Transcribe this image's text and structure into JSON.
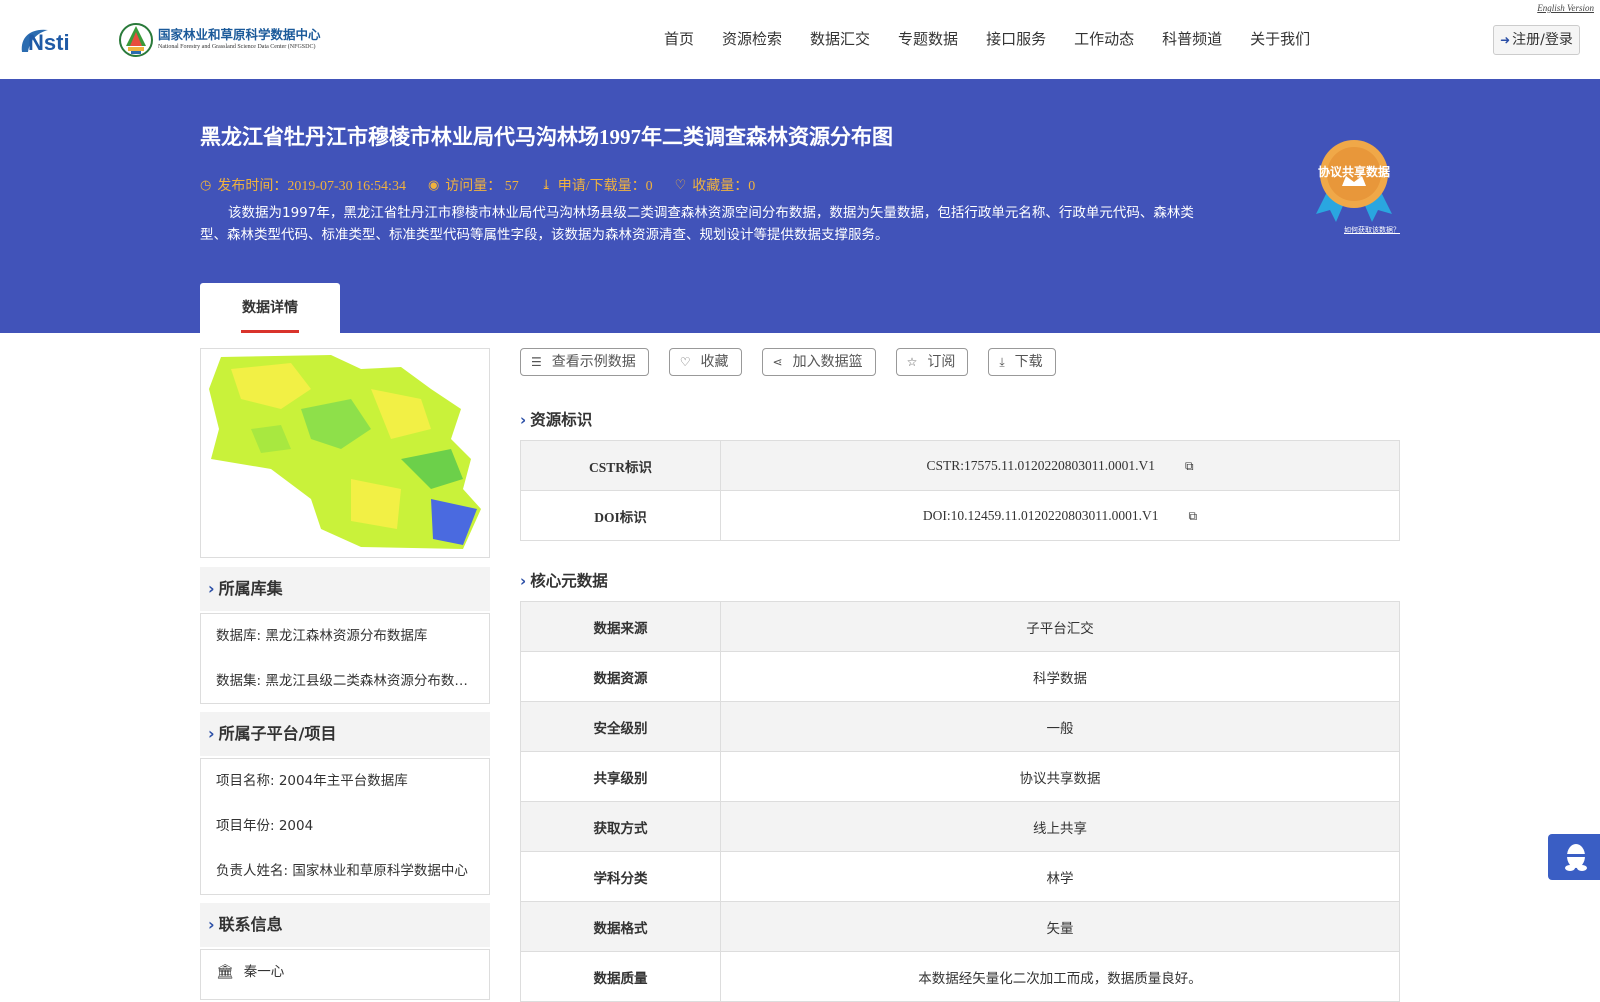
{
  "header": {
    "english_link": "English Version",
    "logo_nsti": "NSTI",
    "center_name_cn": "国家林业和草原科学数据中心",
    "center_name_en": "National Forestry and Grassland Science Data Center (NFGSDC)",
    "nav": [
      "首页",
      "资源检索",
      "数据汇交",
      "专题数据",
      "接口服务",
      "工作动态",
      "科普频道",
      "关于我们"
    ],
    "login": "注册/登录"
  },
  "banner": {
    "title": "黑龙江省牡丹江市穆棱市林业局代马沟林场1997年二类调查森林资源分布图",
    "publish": "发布时间：2019-07-30 16:54:34",
    "visits": "访问量：  57",
    "downloads": "申请/下载量：0",
    "favorites": "收藏量：0",
    "description": "该数据为1997年，黑龙江省牡丹江市穆棱市林业局代马沟林场县级二类调查森林资源空间分布数据，数据为矢量数据，包括行政单元名称、行政单元代码、森林类型、森林类型代码、标准类型、标准类型代码等属性字段，该数据为森林资源清查、规划设计等提供数据支撑服务。",
    "badge_text": "协议共享数据",
    "howto": "如何获取该数据？",
    "tab": "数据详情"
  },
  "left": {
    "library_title": "所属库集",
    "library_rows": [
      "数据库: 黑龙江森林资源分布数据库",
      "数据集: 黑龙江县级二类森林资源分布数据集"
    ],
    "project_title": "所属子平台/项目",
    "project_rows": [
      "项目名称: 2004年主平台数据库",
      "项目年份: 2004",
      "负责人姓名: 国家林业和草原科学数据中心"
    ],
    "contact_title": "联系信息",
    "contact_rows": [
      "秦一心"
    ]
  },
  "actions": [
    "查看示例数据",
    "收藏",
    "加入数据篮",
    "订阅",
    "下载"
  ],
  "resource_id": {
    "title": "资源标识",
    "rows": [
      {
        "key": "CSTR标识",
        "value": "CSTR:17575.11.0120220803011.0001.V1"
      },
      {
        "key": "DOI标识",
        "value": "DOI:10.12459.11.0120220803011.0001.V1"
      }
    ]
  },
  "core_meta": {
    "title": "核心元数据",
    "rows": [
      {
        "key": "数据来源",
        "value": "子平台汇交"
      },
      {
        "key": "数据资源",
        "value": "科学数据"
      },
      {
        "key": "安全级别",
        "value": "一般"
      },
      {
        "key": "共享级别",
        "value": "协议共享数据"
      },
      {
        "key": "获取方式",
        "value": "线上共享"
      },
      {
        "key": "学科分类",
        "value": "林学"
      },
      {
        "key": "数据格式",
        "value": "矢量"
      },
      {
        "key": "数据质量",
        "value": "本数据经矢量化二次加工而成，数据质量良好。"
      }
    ]
  },
  "colors": {
    "banner": "#4153b9",
    "meta": "#f0b23e",
    "tab_underline": "#d9332b",
    "accent": "#2a4ea6"
  }
}
